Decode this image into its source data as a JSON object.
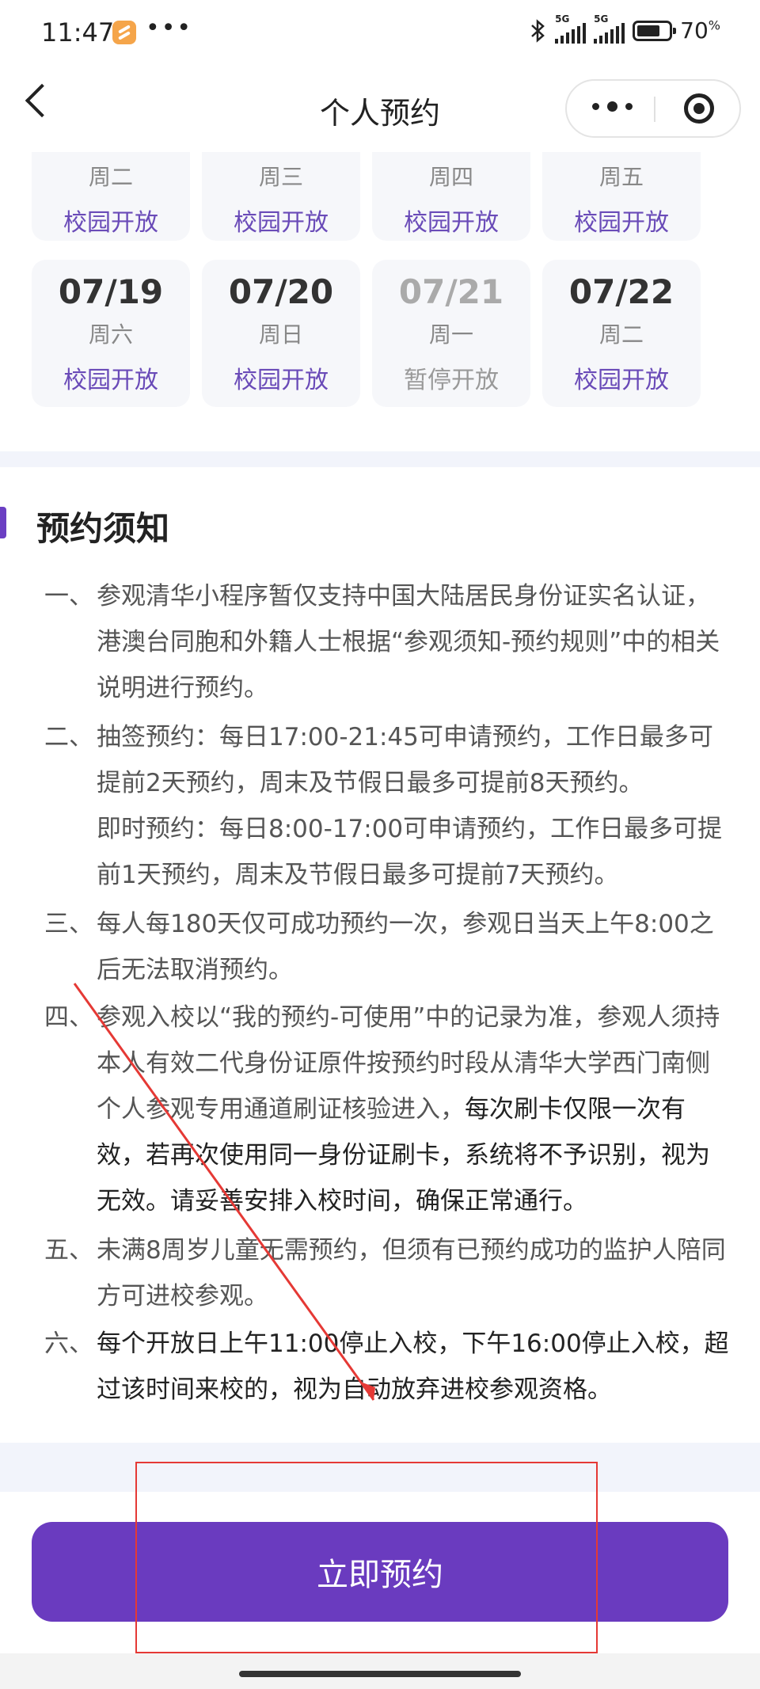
{
  "status": {
    "time": "11:47",
    "dots": "•••",
    "net1": "5G",
    "net2": "5G",
    "battery": "70",
    "battery_unit": "%"
  },
  "nav": {
    "title": "个人预约"
  },
  "calendar": {
    "top_row": [
      {
        "weekday": "周二",
        "status": "校园开放"
      },
      {
        "weekday": "周三",
        "status": "校园开放"
      },
      {
        "weekday": "周四",
        "status": "校园开放"
      },
      {
        "weekday": "周五",
        "status": "校园开放"
      }
    ],
    "bottom_row": [
      {
        "date": "07/19",
        "weekday": "周六",
        "status": "校园开放"
      },
      {
        "date": "07/20",
        "weekday": "周日",
        "status": "校园开放"
      },
      {
        "date": "07/21",
        "weekday": "周一",
        "status": "暂停开放"
      },
      {
        "date": "07/22",
        "weekday": "周二",
        "status": "校园开放"
      }
    ]
  },
  "notice": {
    "title": "预约须知",
    "items": [
      {
        "num": "一、",
        "text": "参观清华小程序暂仅支持中国大陆居民身份证实名认证，港澳台同胞和外籍人士根据“参观须知-预约规则”中的相关说明进行预约。"
      },
      {
        "num": "二、",
        "text": "抽签预约：每日17:00-21:45可申请预约，工作日最多可提前2天预约，周末及节假日最多可提前8天预约。",
        "text2": "即时预约：每日8:00-17:00可申请预约，工作日最多可提前1天预约，周末及节假日最多可提前7天预约。"
      },
      {
        "num": "三、",
        "text": "每人每180天仅可成功预约一次，参观日当天上午8:00之后无法取消预约。"
      },
      {
        "num": "四、",
        "text": "参观入校以“我的预约-可使用”中的记录为准，参观人须持本人有效二代身份证原件按预约时段从清华大学西门南侧个人参观专用通道刷证核验进入，",
        "text_dark": "每次刷卡仅限一次有效，若再次使用同一身份证刷卡，系统将不予识别，视为无效。请妥善安排入校时间，确保正常通行。"
      },
      {
        "num": "五、",
        "text": "未满8周岁儿童无需预约，但须有已预约成功的监护人陪同方可进校参观。"
      },
      {
        "num": "六、",
        "text_dark": "每个开放日上午11:00停止入校，下午16:00停止入校，超过该时间来校的，视为自动放弃进校参观资格。"
      }
    ]
  },
  "button": {
    "label": "立即预约"
  },
  "colors": {
    "accent": "#6a3bbf",
    "status_open": "#6a4bb8",
    "annotation": "#e53935"
  }
}
